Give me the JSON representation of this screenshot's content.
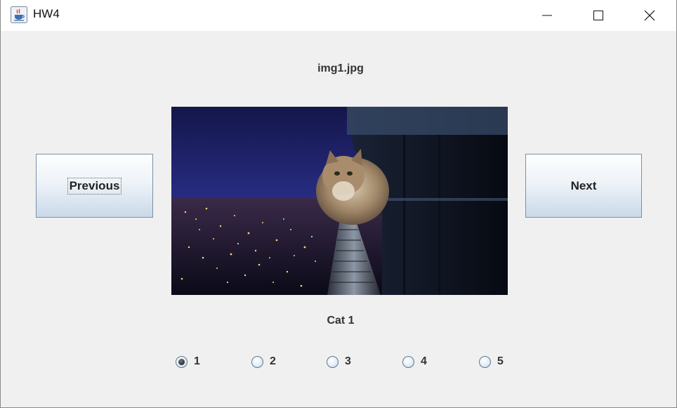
{
  "window": {
    "title": "HW4",
    "app_icon": "java-cup-icon",
    "controls": {
      "minimize": "minimize-icon",
      "maximize": "maximize-icon",
      "close": "close-icon"
    }
  },
  "viewer": {
    "filename": "img1.jpg",
    "caption": "Cat 1",
    "image": "cat-on-railing-night-city-photo",
    "previous_label": "Previous",
    "next_label": "Next"
  },
  "radios": {
    "selected": "1",
    "options": [
      "1",
      "2",
      "3",
      "4",
      "5"
    ]
  },
  "colors": {
    "window_bg": "#f0f0f0",
    "button_gradient_top": "#fdfefe",
    "button_gradient_bottom": "#c9d9e9",
    "button_border": "#7a8fa8"
  }
}
